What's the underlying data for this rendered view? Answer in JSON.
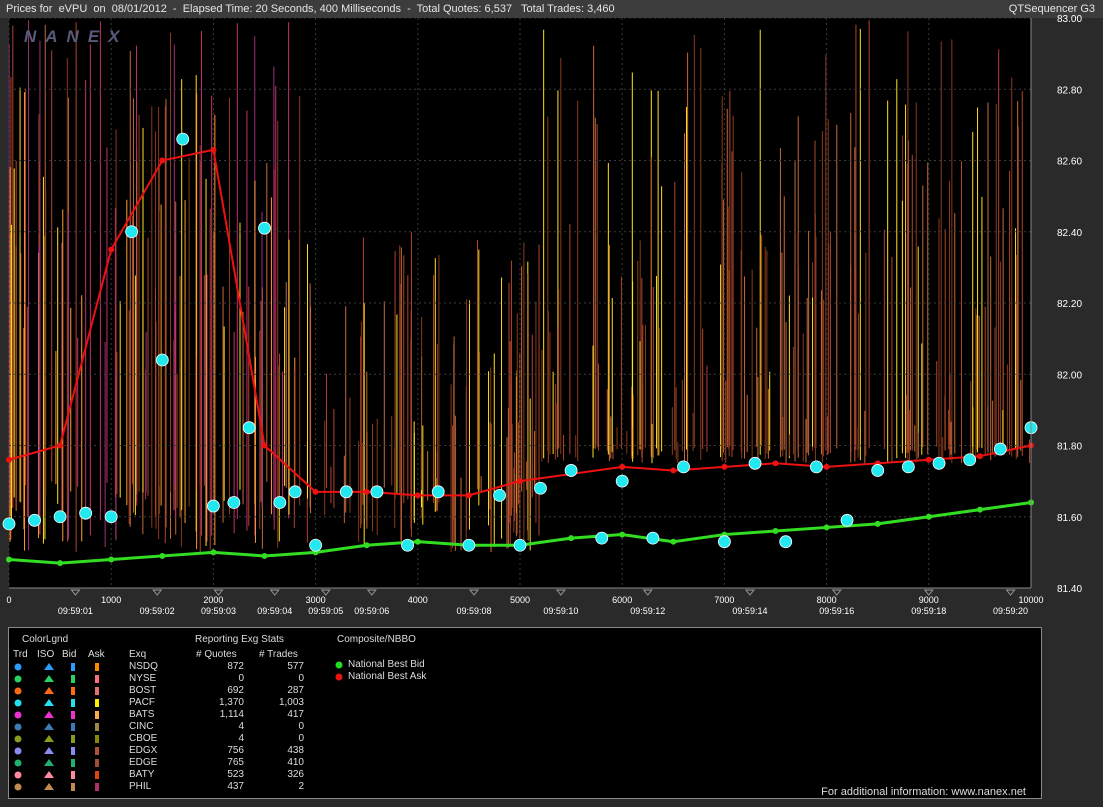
{
  "window": {
    "title": "Prices for  eVPU  on  08/01/2012  -  Elapsed Time: 20 Seconds, 400 Milliseconds  -  Total Quotes: 6,537   Total Trades: 3,460",
    "app_name": "QTSequencer G3",
    "watermark": "NANEX"
  },
  "chart_data": {
    "type": "line",
    "xlim": [
      0,
      10000
    ],
    "ylim": [
      81.4,
      83.0
    ],
    "x_ticks": [
      0,
      1000,
      2000,
      3000,
      4000,
      5000,
      6000,
      7000,
      8000,
      9000,
      10000
    ],
    "y_ticks": [
      "81.40",
      "81.60",
      "81.80",
      "82.00",
      "82.20",
      "82.40",
      "82.60",
      "82.80",
      "83.00"
    ],
    "time_labels": [
      {
        "x": 650,
        "label": "09:59:01"
      },
      {
        "x": 1450,
        "label": "09:59:02"
      },
      {
        "x": 2050,
        "label": "09:59:03"
      },
      {
        "x": 2600,
        "label": "09:59:04"
      },
      {
        "x": 3100,
        "label": "09:59:05"
      },
      {
        "x": 3550,
        "label": "09:59:06"
      },
      {
        "x": 4550,
        "label": "09:59:08"
      },
      {
        "x": 5400,
        "label": "09:59:10"
      },
      {
        "x": 6250,
        "label": "09:59:12"
      },
      {
        "x": 7250,
        "label": "09:59:14"
      },
      {
        "x": 8100,
        "label": "09:59:16"
      },
      {
        "x": 9000,
        "label": "09:59:18"
      },
      {
        "x": 9800,
        "label": "09:59:20"
      }
    ],
    "series": [
      {
        "name": "National Best Bid",
        "color": "#33dd22",
        "x": [
          0,
          500,
          1000,
          1500,
          2000,
          2500,
          3000,
          3500,
          4000,
          4500,
          5000,
          5500,
          6000,
          6500,
          7000,
          7500,
          8000,
          8500,
          9000,
          9500,
          10000
        ],
        "y": [
          81.48,
          81.47,
          81.48,
          81.49,
          81.5,
          81.49,
          81.5,
          81.52,
          81.53,
          81.52,
          81.52,
          81.54,
          81.55,
          81.53,
          81.55,
          81.56,
          81.57,
          81.58,
          81.6,
          81.62,
          81.64
        ]
      },
      {
        "name": "National Best Ask",
        "color": "#ee1111",
        "x": [
          0,
          500,
          1000,
          1500,
          2000,
          2500,
          3000,
          3500,
          4000,
          4500,
          5000,
          5500,
          6000,
          6500,
          7000,
          7500,
          8000,
          8500,
          9000,
          9500,
          10000
        ],
        "y": [
          81.76,
          81.8,
          82.35,
          82.6,
          82.63,
          81.8,
          81.67,
          81.67,
          81.66,
          81.66,
          81.7,
          81.72,
          81.74,
          81.73,
          81.74,
          81.75,
          81.74,
          81.75,
          81.76,
          81.77,
          81.8
        ]
      },
      {
        "name": "Trades",
        "x": [
          0,
          250,
          500,
          750,
          1000,
          1200,
          1500,
          1700,
          2000,
          2200,
          2350,
          2500,
          2650,
          2800,
          3000,
          3300,
          3600,
          3900,
          4200,
          4500,
          4800,
          5000,
          5200,
          5500,
          5800,
          6000,
          6300,
          6600,
          7000,
          7300,
          7600,
          7900,
          8200,
          8500,
          8800,
          9100,
          9400,
          9700,
          10000
        ],
        "y": [
          81.58,
          81.59,
          81.6,
          81.61,
          81.6,
          82.4,
          82.04,
          82.66,
          81.63,
          81.64,
          81.85,
          82.41,
          81.64,
          81.67,
          81.52,
          81.67,
          81.67,
          81.52,
          81.67,
          81.52,
          81.66,
          81.52,
          81.68,
          81.73,
          81.54,
          81.7,
          81.54,
          81.74,
          81.53,
          81.75,
          81.53,
          81.74,
          81.59,
          81.73,
          81.74,
          81.75,
          81.76,
          81.79,
          81.85
        ]
      }
    ],
    "background_quotes": {
      "colors": [
        "#8a3a1a",
        "#b0442a",
        "#c26a3a",
        "#ff9a30",
        "#ffe020",
        "#9a2f7a",
        "#c0306a"
      ]
    },
    "grid": true
  },
  "legend": {
    "color_legend_title": "ColorLgnd",
    "columns": [
      "Trd",
      "ISO",
      "Bid",
      "Ask",
      "Exq"
    ],
    "stats_title": "Reporting Exg Stats",
    "stats_columns": [
      "# Quotes",
      "# Trades"
    ],
    "exchanges": [
      {
        "name": "NSDQ",
        "quotes": "872",
        "trades": "577",
        "color": "#2a9cff",
        "ask": "#ff8800"
      },
      {
        "name": "NYSE",
        "quotes": "0",
        "trades": "0",
        "color": "#2ad060",
        "ask": "#ff6e80"
      },
      {
        "name": "BOST",
        "quotes": "692",
        "trades": "287",
        "color": "#ff6a10",
        "ask": "#e07070"
      },
      {
        "name": "PACF",
        "quotes": "1,370",
        "trades": "1,003",
        "color": "#22e0f0",
        "ask": "#ffee00"
      },
      {
        "name": "BATS",
        "quotes": "1,114",
        "trades": "417",
        "color": "#ee30cc",
        "ask": "#ffaa44"
      },
      {
        "name": "CINC",
        "quotes": "4",
        "trades": "0",
        "color": "#3d7ab8",
        "ask": "#a08840"
      },
      {
        "name": "CBOE",
        "quotes": "4",
        "trades": "0",
        "color": "#8a9a20",
        "ask": "#888800"
      },
      {
        "name": "EDGX",
        "quotes": "756",
        "trades": "438",
        "color": "#8a8af0",
        "ask": "#b0503a"
      },
      {
        "name": "EDGE",
        "quotes": "765",
        "trades": "410",
        "color": "#20b070",
        "ask": "#a05030"
      },
      {
        "name": "BATY",
        "quotes": "523",
        "trades": "326",
        "color": "#ff8aa0",
        "ask": "#dd4410"
      },
      {
        "name": "PHIL",
        "quotes": "437",
        "trades": "2",
        "color": "#c08a50",
        "ask": "#b02e6a"
      }
    ],
    "composite_title": "Composite/NBBO",
    "composite_items": [
      {
        "label": "National Best Bid",
        "color": "#22dd22"
      },
      {
        "label": "National Best Ask",
        "color": "#ee1111"
      }
    ],
    "credit": "For additional information: www.nanex.net"
  }
}
